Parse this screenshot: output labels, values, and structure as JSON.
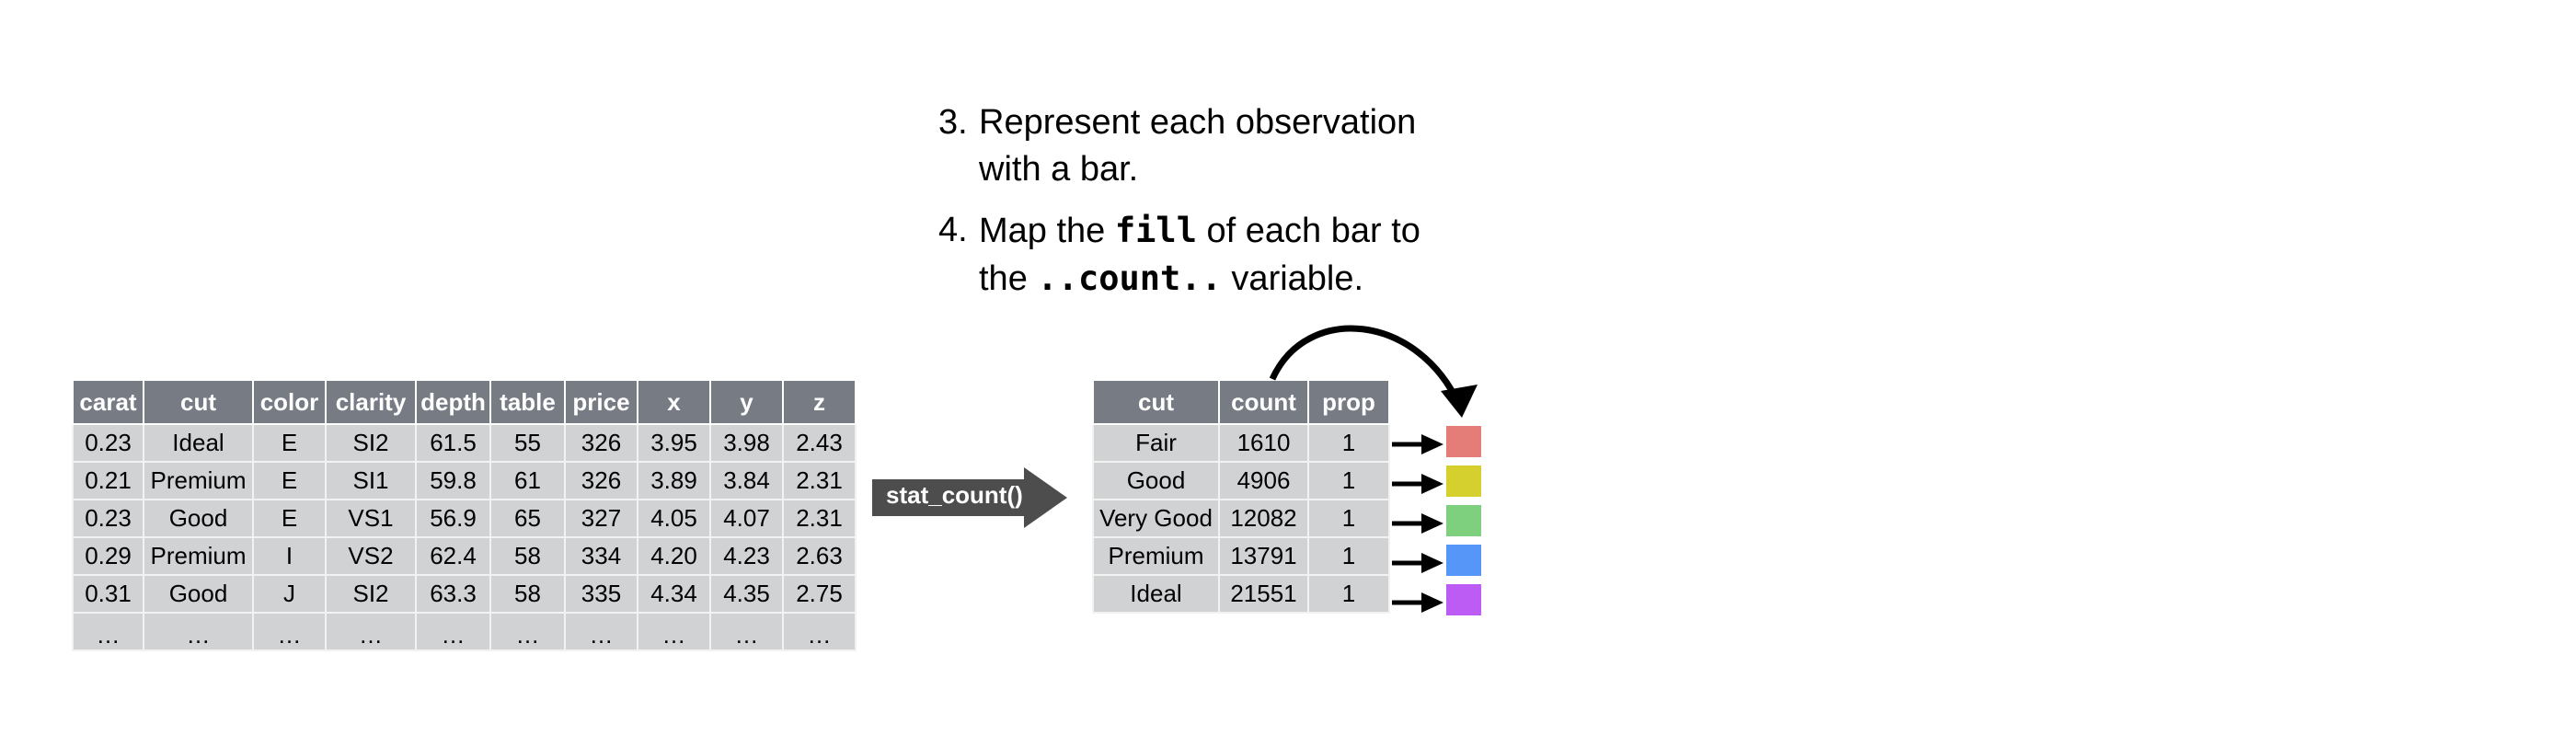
{
  "steps": [
    {
      "number": "3.",
      "line1": "Represent each observation",
      "line2": "with a bar."
    },
    {
      "number": "4.",
      "pre": "Map the ",
      "code1": "fill",
      "mid": " of each bar to",
      "line2_pre": "the ",
      "code2": "..count..",
      "line2_post": " variable."
    }
  ],
  "raw_table": {
    "columns": [
      "carat",
      "cut",
      "color",
      "clarity",
      "depth",
      "table",
      "price",
      "x",
      "y",
      "z"
    ],
    "rows": [
      [
        "0.23",
        "Ideal",
        "E",
        "SI2",
        "61.5",
        "55",
        "326",
        "3.95",
        "3.98",
        "2.43"
      ],
      [
        "0.21",
        "Premium",
        "E",
        "SI1",
        "59.8",
        "61",
        "326",
        "3.89",
        "3.84",
        "2.31"
      ],
      [
        "0.23",
        "Good",
        "E",
        "VS1",
        "56.9",
        "65",
        "327",
        "4.05",
        "4.07",
        "2.31"
      ],
      [
        "0.29",
        "Premium",
        "I",
        "VS2",
        "62.4",
        "58",
        "334",
        "4.20",
        "4.23",
        "2.63"
      ],
      [
        "0.31",
        "Good",
        "J",
        "SI2",
        "63.3",
        "58",
        "335",
        "4.34",
        "4.35",
        "2.75"
      ],
      [
        "…",
        "…",
        "…",
        "…",
        "…",
        "…",
        "…",
        "…",
        "…",
        "…"
      ]
    ]
  },
  "transform": {
    "label": "stat_count()",
    "icon": "right-arrow-icon",
    "color": "#4d4d4d"
  },
  "stat_table": {
    "columns": [
      "cut",
      "count",
      "prop"
    ],
    "rows": [
      [
        "Fair",
        "1610",
        "1"
      ],
      [
        "Good",
        "4906",
        "1"
      ],
      [
        "Very Good",
        "12082",
        "1"
      ],
      [
        "Premium",
        "13791",
        "1"
      ],
      [
        "Ideal",
        "21551",
        "1"
      ]
    ]
  },
  "fill_swatches": [
    {
      "cut": "Fair",
      "color": "#e47c78"
    },
    {
      "cut": "Good",
      "color": "#d6d02f"
    },
    {
      "cut": "Very Good",
      "color": "#7fd07e"
    },
    {
      "cut": "Premium",
      "color": "#5596f8"
    },
    {
      "cut": "Ideal",
      "color": "#bd5cf5"
    }
  ],
  "colors": {
    "header_bg": "#777b84",
    "cell_bg": "#d1d2d4"
  }
}
